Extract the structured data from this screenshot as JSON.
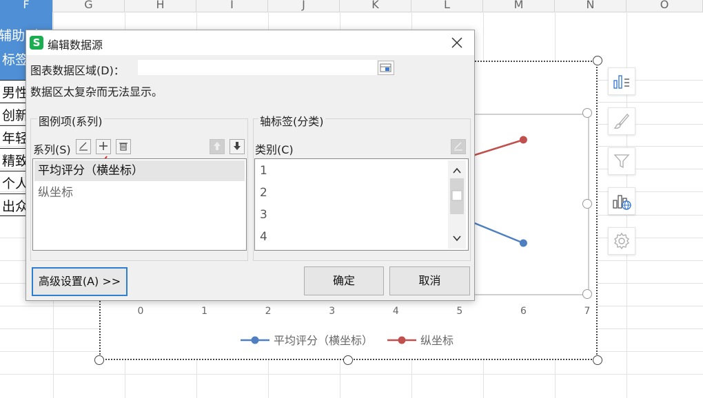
{
  "sheet": {
    "columns": [
      {
        "label": "F",
        "selected": true
      },
      {
        "label": "G",
        "selected": false
      },
      {
        "label": "H",
        "selected": false
      },
      {
        "label": "I",
        "selected": false
      },
      {
        "label": "J",
        "selected": false
      },
      {
        "label": "K",
        "selected": false
      },
      {
        "label": "L",
        "selected": false
      },
      {
        "label": "M",
        "selected": false
      },
      {
        "label": "N",
        "selected": false
      },
      {
        "label": "O",
        "selected": false
      }
    ],
    "header_cell_line1": "辅助列",
    "header_cell_line2": "标签",
    "rows": [
      "男性",
      "创新",
      "年轻",
      "精致",
      "个人",
      "出众"
    ],
    "accent_color": "#4f8fd6"
  },
  "chart": {
    "x_ticks": [
      "0",
      "1",
      "2",
      "3",
      "4",
      "5",
      "6",
      "7"
    ],
    "legend": [
      {
        "name": "平均评分（横坐标）",
        "color": "#4e7fc1"
      },
      {
        "name": "纵坐标",
        "color": "#c0504d"
      }
    ]
  },
  "chart_data": {
    "type": "line",
    "x_ticks": [
      0,
      1,
      2,
      3,
      4,
      5,
      6,
      7
    ],
    "xlim": [
      0,
      7
    ],
    "series": [
      {
        "name": "平均评分（横坐标）",
        "visible_points": [
          {
            "x": 6
          }
        ]
      },
      {
        "name": "纵坐标",
        "visible_points": [
          {
            "x": 6
          }
        ]
      }
    ],
    "legend_position": "bottom"
  },
  "side_tools": [
    "chart-elements-icon",
    "chart-style-icon",
    "chart-filter-icon",
    "chart-online-icon",
    "chart-settings-icon"
  ],
  "dialog": {
    "title": "编辑数据源",
    "app_logo": "S",
    "range_label": "图表数据区域(D)：",
    "range_value": "",
    "complex_msg": "数据区太复杂而无法显示。",
    "legend_group_title": "图例项(系列)",
    "axis_group_title": "轴标签(分类)",
    "series_label": "系列(S)",
    "category_label": "类别(C)",
    "series_items": [
      "平均评分（横坐标）",
      "纵坐标"
    ],
    "category_items": [
      "1",
      "2",
      "3",
      "4"
    ],
    "advanced_btn": "高级设置(A) >>",
    "ok_btn": "确定",
    "cancel_btn": "取消"
  }
}
